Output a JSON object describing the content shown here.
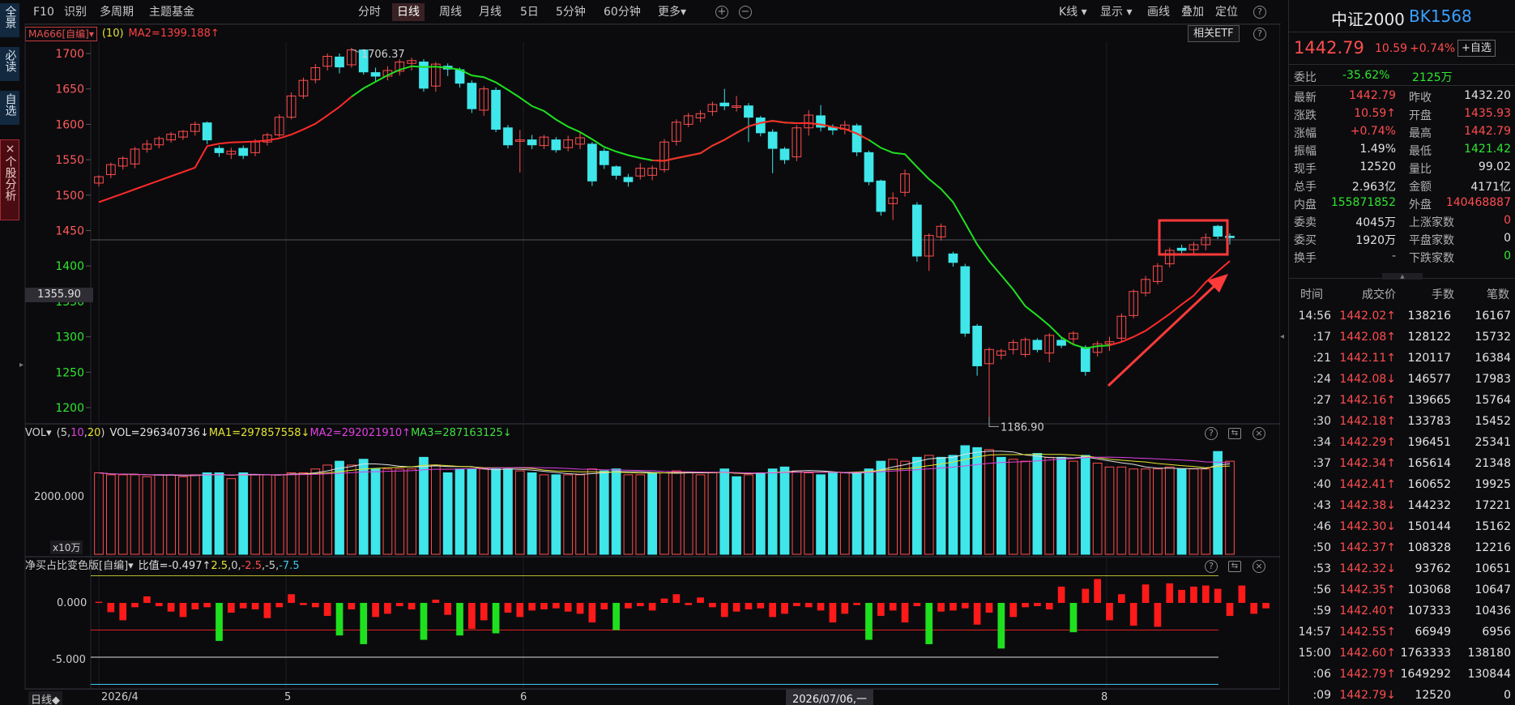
{
  "left_tabs": [
    {
      "label": "全景"
    },
    {
      "label": "必读"
    },
    {
      "label": "自选"
    },
    {
      "label": "×个股分析"
    }
  ],
  "topbar": {
    "left": [
      "F10",
      "识别",
      "多周期",
      "主题基金"
    ],
    "periods": [
      "分时",
      "日线",
      "周线",
      "月线",
      "5日",
      "5分钟",
      "60分钟",
      "更多▾"
    ],
    "active_period": "日线",
    "right": [
      "K线 ▾",
      "显示 ▾",
      "画线",
      "叠加",
      "定位"
    ]
  },
  "ma_row": {
    "chip": "MA666[自编]▾",
    "param": "(10)",
    "ma2": "MA2=1399.188↑",
    "etf_button": "相关ETF"
  },
  "price_axis": [
    "1700",
    "1650",
    "1600",
    "1550",
    "1500",
    "1450",
    "1400",
    "1350",
    "1300",
    "1250",
    "1200"
  ],
  "cursor_price": "1355.90",
  "annotations": {
    "high": "1706.37",
    "low": "1186.90"
  },
  "vol_row": {
    "label": "VOL▾",
    "params": [
      "(5,",
      "10",
      ",",
      "20",
      ")"
    ],
    "vol": "VOL=296340736↓",
    "ma1": "MA1=297857558↓",
    "ma2": "MA2=292021910↑",
    "ma3": "MA3=287163125↓",
    "axis_value": "2000.000",
    "unit": "x10万"
  },
  "net_row": {
    "label": "净买占比变色版[自编]▾",
    "formula": "比值=-0.497↑",
    "params": [
      {
        "text": "2.5",
        "color": "#e3e330"
      },
      {
        "text": ",0,",
        "color": "#cfcfcf"
      },
      {
        "text": "-2.5",
        "color": "#ff4d4d"
      },
      {
        "text": ",-5,",
        "color": "#cfcfcf"
      },
      {
        "text": "-7.5",
        "color": "#3fc8f0"
      }
    ],
    "axis": [
      "0.000",
      "-5.000"
    ]
  },
  "bottom": {
    "tag": "日线◆",
    "dates": [
      "2026/4",
      "5",
      "6",
      "8"
    ],
    "cursor_date": "2026/07/06,一"
  },
  "chart_data": {
    "type": "candlestick",
    "y_range": [
      1180,
      1710
    ],
    "ma_line": {
      "name": "MA2",
      "value": "1399.188"
    },
    "candles": [
      [
        1517,
        1526,
        1512,
        1528,
        0,
        0.42
      ],
      [
        1529,
        1543,
        1524,
        1546,
        0,
        0.41
      ],
      [
        1541,
        1552,
        1536,
        1555,
        0,
        0.41
      ],
      [
        1544,
        1565,
        1538,
        1568,
        0,
        0.41
      ],
      [
        1565,
        1572,
        1560,
        1578,
        0,
        0.4
      ],
      [
        1571,
        1580,
        1566,
        1583,
        0,
        0.41
      ],
      [
        1578,
        1586,
        1574,
        1589,
        0,
        0.41
      ],
      [
        1582,
        1590,
        1578,
        1592,
        0,
        0.4
      ],
      [
        1590,
        1600,
        1584,
        1604,
        0,
        0.41
      ],
      [
        1602,
        1578,
        1572,
        1604,
        1,
        0.42
      ],
      [
        1566,
        1560,
        1554,
        1570,
        1,
        0.42
      ],
      [
        1558,
        1562,
        1551,
        1567,
        0,
        0.39
      ],
      [
        1566,
        1556,
        1551,
        1570,
        1,
        0.42
      ],
      [
        1560,
        1575,
        1555,
        1579,
        0,
        0.41
      ],
      [
        1575,
        1585,
        1570,
        1588,
        0,
        0.41
      ],
      [
        1585,
        1610,
        1582,
        1614,
        0,
        0.41
      ],
      [
        1610,
        1640,
        1607,
        1645,
        0,
        0.42
      ],
      [
        1640,
        1662,
        1636,
        1666,
        0,
        0.42
      ],
      [
        1663,
        1680,
        1658,
        1685,
        0,
        0.44
      ],
      [
        1682,
        1696,
        1676,
        1700,
        0,
        0.46
      ],
      [
        1695,
        1681,
        1672,
        1700,
        1,
        0.48
      ],
      [
        1684,
        1705,
        1680,
        1708,
        0,
        0.46
      ],
      [
        1705,
        1674,
        1670,
        1706,
        1,
        0.49
      ],
      [
        1673,
        1668,
        1660,
        1680,
        1,
        0.44
      ],
      [
        1668,
        1676,
        1662,
        1682,
        0,
        0.44
      ],
      [
        1675,
        1688,
        1669,
        1692,
        0,
        0.44
      ],
      [
        1686,
        1690,
        1676,
        1694,
        0,
        0.44
      ],
      [
        1688,
        1651,
        1646,
        1692,
        1,
        0.5
      ],
      [
        1654,
        1685,
        1646,
        1688,
        0,
        0.46
      ],
      [
        1682,
        1678,
        1668,
        1686,
        1,
        0.42
      ],
      [
        1677,
        1658,
        1652,
        1680,
        1,
        0.44
      ],
      [
        1658,
        1622,
        1616,
        1662,
        1,
        0.44
      ],
      [
        1620,
        1650,
        1612,
        1654,
        0,
        0.44
      ],
      [
        1648,
        1593,
        1589,
        1652,
        1,
        0.44
      ],
      [
        1595,
        1571,
        1566,
        1599,
        1,
        0.44
      ],
      [
        1576,
        1578,
        1532,
        1592,
        0,
        0.43
      ],
      [
        1578,
        1571,
        1565,
        1585,
        1,
        0.42
      ],
      [
        1570,
        1582,
        1565,
        1585,
        0,
        0.41
      ],
      [
        1578,
        1564,
        1560,
        1582,
        1,
        0.41
      ],
      [
        1567,
        1578,
        1562,
        1584,
        0,
        0.41
      ],
      [
        1572,
        1581,
        1565,
        1590,
        0,
        0.41
      ],
      [
        1572,
        1520,
        1513,
        1575,
        0,
        0.44
      ],
      [
        1562,
        1543,
        1537,
        1566,
        1,
        0.43
      ],
      [
        1540,
        1528,
        1522,
        1542,
        1,
        0.44
      ],
      [
        1525,
        1519,
        1512,
        1530,
        0,
        0.41
      ],
      [
        1527,
        1538,
        1522,
        1545,
        0,
        0.41
      ],
      [
        1528,
        1538,
        1521,
        1542,
        1,
        0.42
      ],
      [
        1536,
        1575,
        1532,
        1579,
        0,
        0.42
      ],
      [
        1576,
        1603,
        1570,
        1607,
        0,
        0.43
      ],
      [
        1600,
        1612,
        1596,
        1616,
        0,
        0.42
      ],
      [
        1609,
        1615,
        1603,
        1620,
        0,
        0.41
      ],
      [
        1618,
        1628,
        1612,
        1632,
        0,
        0.42
      ],
      [
        1630,
        1626,
        1620,
        1650,
        1,
        0.44
      ],
      [
        1624,
        1626,
        1618,
        1640,
        1,
        0.4
      ],
      [
        1626,
        1610,
        1575,
        1630,
        0,
        0.41
      ],
      [
        1609,
        1588,
        1583,
        1612,
        1,
        0.42
      ],
      [
        1589,
        1566,
        1531,
        1593,
        1,
        0.44
      ],
      [
        1565,
        1550,
        1544,
        1568,
        1,
        0.45
      ],
      [
        1554,
        1595,
        1548,
        1599,
        0,
        0.43
      ],
      [
        1595,
        1613,
        1584,
        1620,
        0,
        0.42
      ],
      [
        1612,
        1596,
        1590,
        1627,
        1,
        0.41
      ],
      [
        1596,
        1592,
        1585,
        1600,
        1,
        0.42
      ],
      [
        1593,
        1599,
        1586,
        1605,
        0,
        0.42
      ],
      [
        1598,
        1561,
        1555,
        1601,
        1,
        0.42
      ],
      [
        1560,
        1519,
        1514,
        1563,
        1,
        0.44
      ],
      [
        1520,
        1477,
        1471,
        1522,
        1,
        0.48
      ],
      [
        1488,
        1496,
        1465,
        1504,
        0,
        0.49
      ],
      [
        1504,
        1530,
        1498,
        1536,
        0,
        0.48
      ],
      [
        1486,
        1414,
        1406,
        1490,
        1,
        0.5
      ],
      [
        1414,
        1443,
        1393,
        1446,
        0,
        0.51
      ],
      [
        1441,
        1456,
        1436,
        1460,
        1,
        0.5
      ],
      [
        1417,
        1405,
        1399,
        1420,
        1,
        0.51
      ],
      [
        1399,
        1305,
        1300,
        1403,
        1,
        0.56
      ],
      [
        1315,
        1259,
        1245,
        1318,
        1,
        0.55
      ],
      [
        1262,
        1282,
        1187,
        1285,
        0,
        0.54
      ],
      [
        1274,
        1280,
        1268,
        1283,
        1,
        0.5
      ],
      [
        1282,
        1292,
        1275,
        1296,
        0,
        0.49
      ],
      [
        1275,
        1296,
        1271,
        1299,
        0,
        0.48
      ],
      [
        1295,
        1282,
        1278,
        1298,
        1,
        0.52
      ],
      [
        1277,
        1302,
        1264,
        1305,
        0,
        0.5
      ],
      [
        1295,
        1288,
        1284,
        1300,
        1,
        0.5
      ],
      [
        1297,
        1305,
        1290,
        1308,
        0,
        0.48
      ],
      [
        1285,
        1251,
        1245,
        1288,
        1,
        0.51
      ],
      [
        1278,
        1290,
        1272,
        1294,
        0,
        0.47
      ],
      [
        1290,
        1293,
        1280,
        1300,
        0,
        0.45
      ],
      [
        1298,
        1329,
        1294,
        1333,
        0,
        0.45
      ],
      [
        1330,
        1364,
        1326,
        1367,
        0,
        0.44
      ],
      [
        1362,
        1381,
        1357,
        1386,
        0,
        0.44
      ],
      [
        1378,
        1400,
        1374,
        1404,
        0,
        0.44
      ],
      [
        1403,
        1422,
        1398,
        1426,
        0,
        0.45
      ],
      [
        1425,
        1422,
        1416,
        1430,
        1,
        0.44
      ],
      [
        1423,
        1430,
        1417,
        1434,
        0,
        0.44
      ],
      [
        1430,
        1440,
        1422,
        1446,
        0,
        0.44
      ],
      [
        1456,
        1442,
        1438,
        1458,
        1,
        0.53
      ],
      [
        1442,
        1440,
        1430,
        1446,
        0,
        0.48
      ]
    ],
    "net_buy": [
      0.1,
      -0.85,
      -1.6,
      -0.4,
      0.6,
      -0.3,
      -0.8,
      -1.3,
      -0.6,
      -0.4,
      -3.5,
      -0.9,
      -0.5,
      -0.6,
      -1.4,
      -0.4,
      0.8,
      -0.2,
      -0.4,
      -1.2,
      -3.0,
      -0.6,
      -3.8,
      -1.3,
      -1.0,
      -0.3,
      -0.6,
      -3.4,
      0.3,
      -1.1,
      -3.0,
      -2.4,
      -1.6,
      -2.8,
      -0.9,
      -1.3,
      -0.7,
      -0.6,
      -0.5,
      -0.8,
      -1.0,
      -1.8,
      -0.6,
      -2.5,
      -0.5,
      -0.3,
      -0.7,
      0.4,
      0.8,
      -0.2,
      0.5,
      -0.4,
      -1.3,
      -0.8,
      -0.6,
      -0.5,
      -1.3,
      -1.0,
      -0.3,
      -0.4,
      -0.7,
      -1.8,
      -1.0,
      -0.2,
      -3.4,
      -1.2,
      -0.7,
      -1.8,
      -0.3,
      -3.8,
      -0.8,
      -0.7,
      -0.5,
      -2.0,
      -0.9,
      -4.2,
      -1.3,
      -0.4,
      -0.3,
      -0.6,
      1.5,
      -2.7,
      1.3,
      2.2,
      -1.6,
      0.8,
      -2.1,
      1.7,
      -2.2,
      1.8,
      1.2,
      1.5,
      1.6,
      1.3,
      -1.2,
      1.6,
      -1.0,
      -0.5
    ]
  },
  "panel": {
    "name": "中证2000",
    "code": "BK1568",
    "price": "1442.79",
    "change": "10.59",
    "pct": "+0.74%",
    "add_btn": "+自选",
    "webi": {
      "label": "委比",
      "pct": "-35.62%",
      "amount": "2125万"
    },
    "stats": [
      {
        "l": "最新",
        "v": "1442.79",
        "vc": "red",
        "l2": "昨收",
        "v2": "1432.20",
        "v2c": "wht"
      },
      {
        "l": "涨跌",
        "v": "10.59↑",
        "vc": "red",
        "l2": "开盘",
        "v2": "1435.93",
        "v2c": "red"
      },
      {
        "l": "涨幅",
        "v": "+0.74%",
        "vc": "red",
        "l2": "最高",
        "v2": "1442.79",
        "v2c": "red"
      },
      {
        "l": "振幅",
        "v": "1.49%",
        "vc": "wht",
        "l2": "最低",
        "v2": "1421.42",
        "v2c": "green"
      },
      {
        "l": "现手",
        "v": "12520",
        "vc": "wht",
        "l2": "量比",
        "v2": "99.02",
        "v2c": "wht"
      },
      {
        "l": "总手",
        "v": "2.963亿",
        "vc": "wht",
        "l2": "金额",
        "v2": "4171亿",
        "v2c": "wht"
      },
      {
        "l": "内盘",
        "v": "155871852",
        "vc": "green",
        "l2": "外盘",
        "v2": "140468887",
        "v2c": "red"
      },
      {
        "l": "委卖",
        "v": "4045万",
        "vc": "wht",
        "l2": "上涨家数",
        "v2": "0",
        "v2c": "red"
      },
      {
        "l": "委买",
        "v": "1920万",
        "vc": "wht",
        "l2": "平盘家数",
        "v2": "0",
        "v2c": "wht"
      },
      {
        "l": "换手",
        "v": "-",
        "vc": "gray",
        "l2": "下跌家数",
        "v2": "0",
        "v2c": "green"
      }
    ],
    "trade_headers": [
      "时间",
      "成交价",
      "手数",
      "笔数"
    ],
    "trades": [
      [
        "14:56",
        "1442.02↑",
        "138216",
        "16167"
      ],
      [
        ":17",
        "1442.08↑",
        "128122",
        "15732"
      ],
      [
        ":21",
        "1442.11↑",
        "120117",
        "16384"
      ],
      [
        ":24",
        "1442.08↓",
        "146577",
        "17983"
      ],
      [
        ":27",
        "1442.16↑",
        "139665",
        "15764"
      ],
      [
        ":30",
        "1442.18↑",
        "133783",
        "15452"
      ],
      [
        ":34",
        "1442.29↑",
        "196451",
        "25341"
      ],
      [
        ":37",
        "1442.34↑",
        "165614",
        "21348"
      ],
      [
        ":40",
        "1442.41↑",
        "160652",
        "19925"
      ],
      [
        ":43",
        "1442.38↓",
        "144232",
        "17221"
      ],
      [
        ":46",
        "1442.30↓",
        "150144",
        "15162"
      ],
      [
        ":50",
        "1442.37↑",
        "108328",
        "12216"
      ],
      [
        ":53",
        "1442.32↓",
        "93762",
        "10651"
      ],
      [
        ":56",
        "1442.35↑",
        "103068",
        "10647"
      ],
      [
        ":59",
        "1442.40↑",
        "107333",
        "10436"
      ],
      [
        "14:57",
        "1442.55↑",
        "66949",
        "6956"
      ],
      [
        "15:00",
        "1442.60↑",
        "1763333",
        "138180"
      ],
      [
        ":06",
        "1442.79↑",
        "1649292",
        "130844"
      ],
      [
        ":09",
        "1442.79↓",
        "12520",
        "0"
      ]
    ]
  },
  "colors": {
    "up": "#ff4d4d",
    "down": "#3fe6ea",
    "ma2": "#ff2a2a",
    "ma_green": "#1fe01f",
    "bg": "#0b0b0e",
    "net_up": "#ff1a1a",
    "net_down": "#1fe01f"
  }
}
